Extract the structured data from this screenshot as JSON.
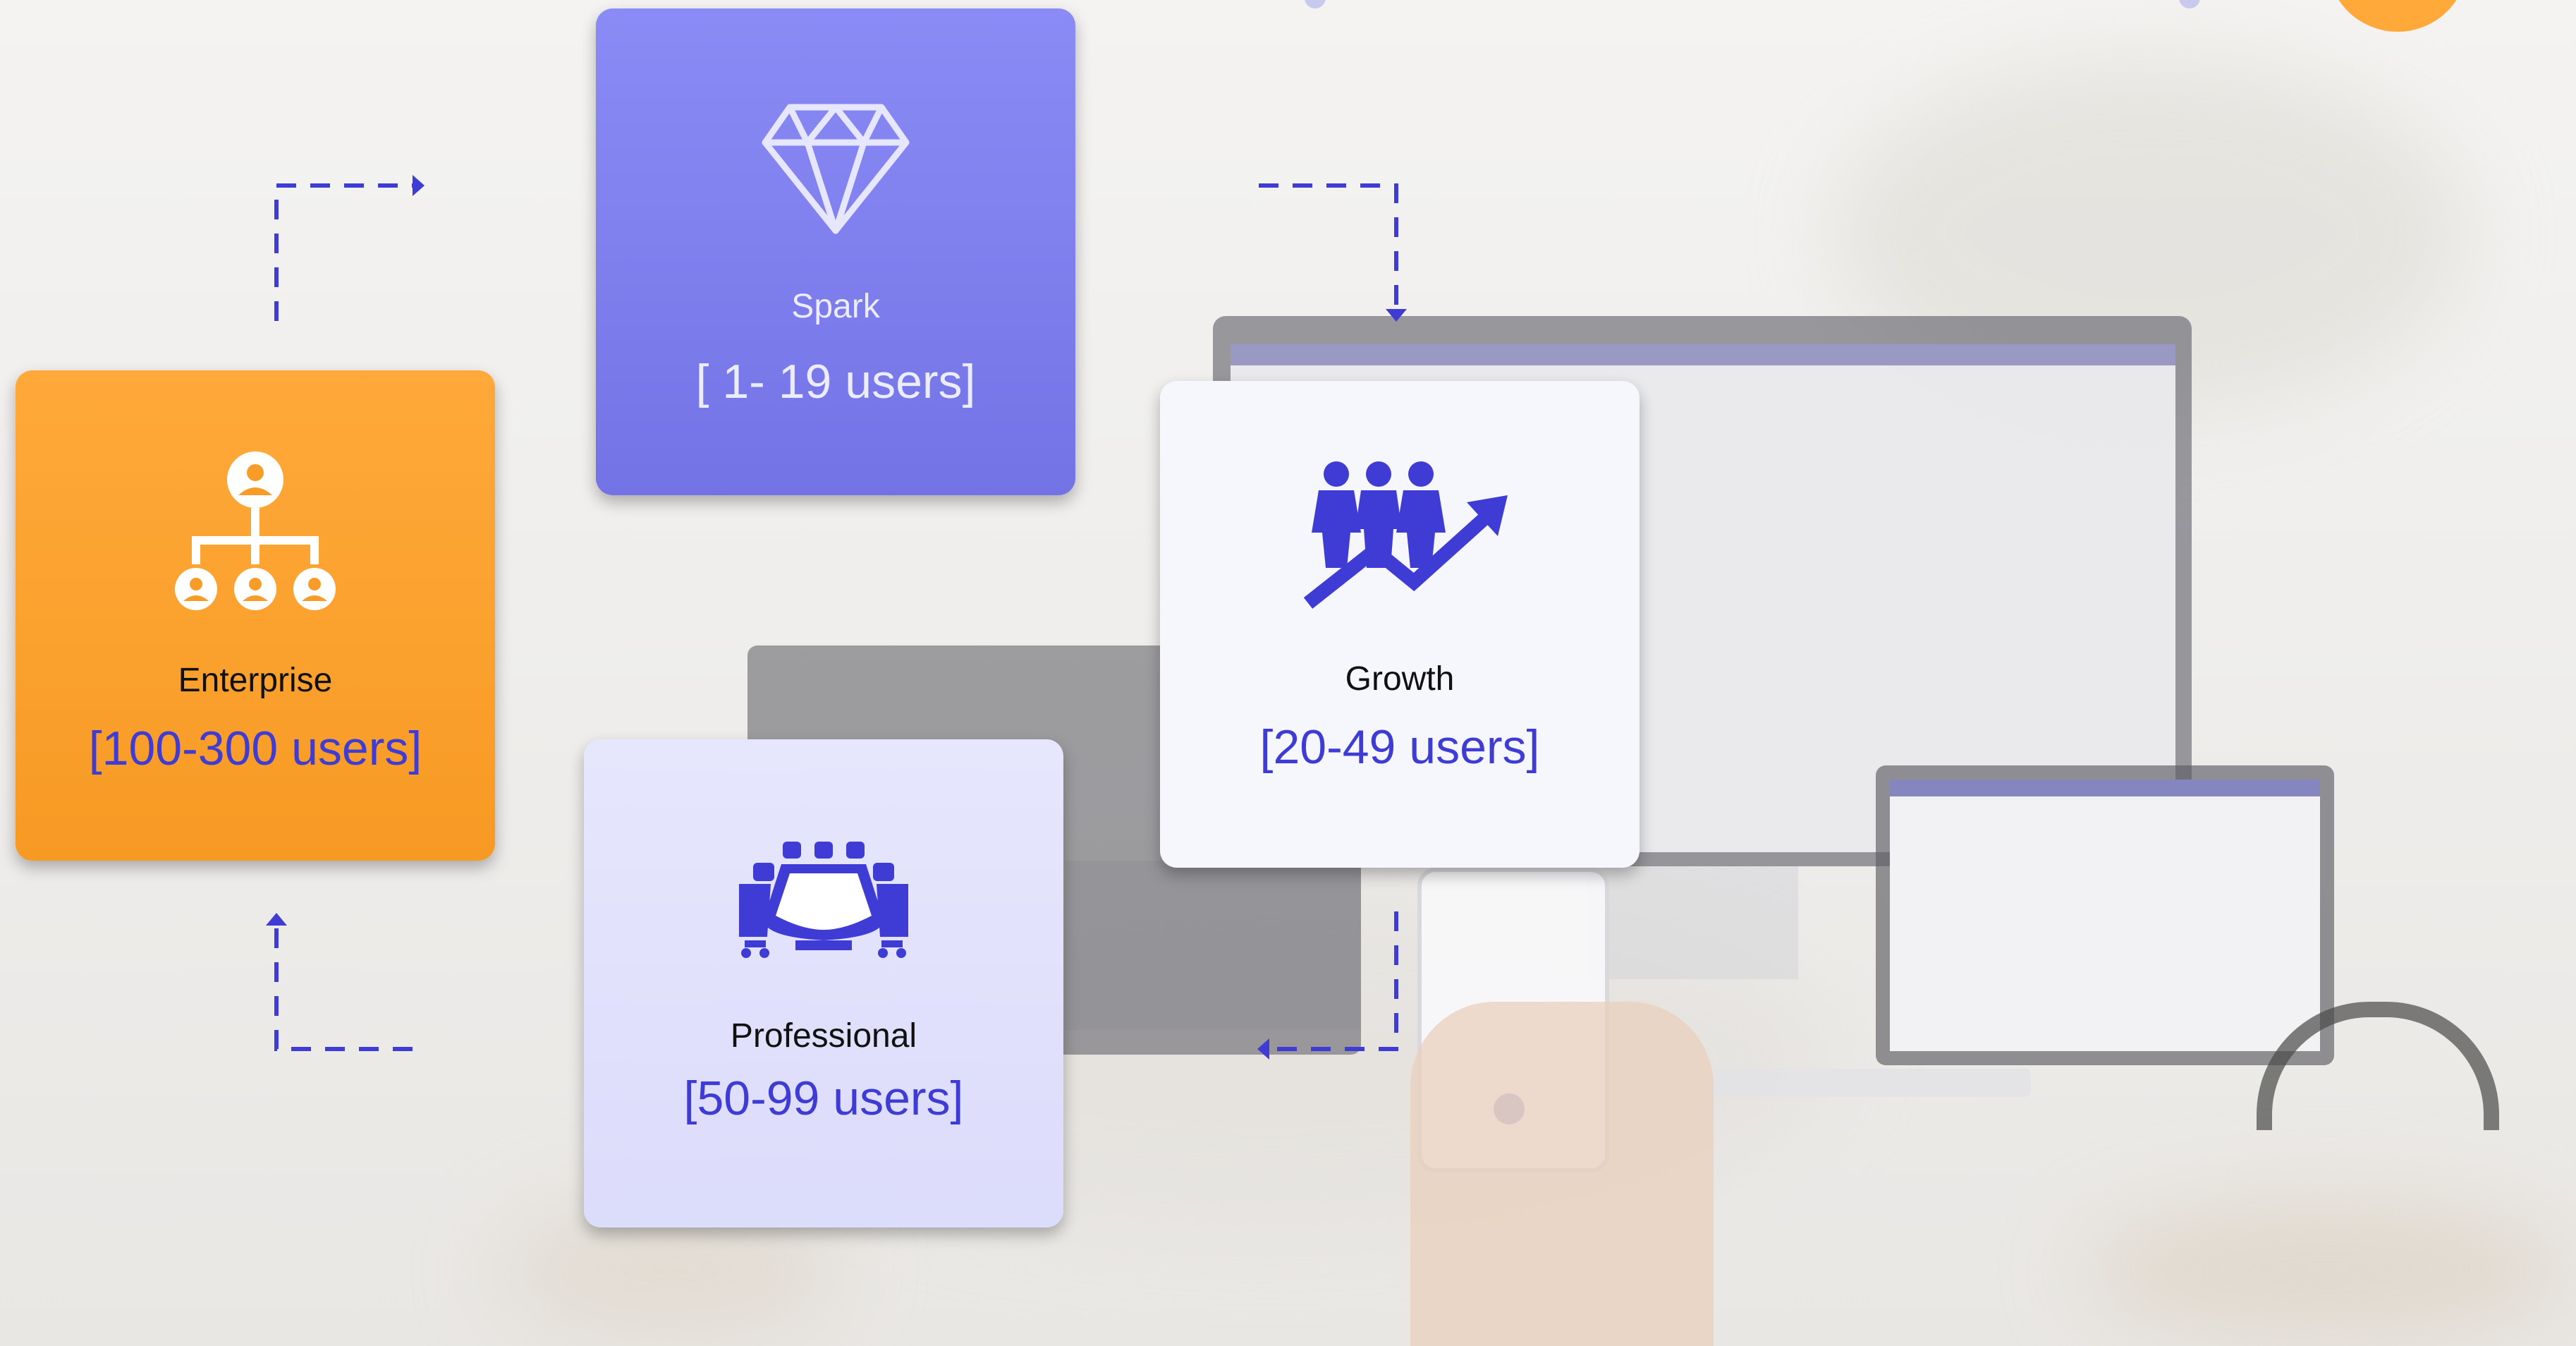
{
  "tiers": {
    "spark": {
      "name": "Spark",
      "users": "[ 1- 19 users]"
    },
    "enterprise": {
      "name": "Enterprise",
      "users": "[100-300 users]"
    },
    "growth": {
      "name": "Growth",
      "users": "[20-49 users]"
    },
    "professional": {
      "name": "Professional",
      "users": "[50-99 users]"
    }
  },
  "icons": {
    "spark": "diamond-icon",
    "enterprise": "org-chart-icon",
    "growth": "team-growth-icon",
    "professional": "conference-table-icon"
  },
  "colors": {
    "accent": "#3f3cd6",
    "spark_bg": "#7d7df0",
    "enterprise_bg": "#f89c28",
    "growth_bg": "#f6f6fd",
    "professional_bg": "#e0e0fc"
  }
}
